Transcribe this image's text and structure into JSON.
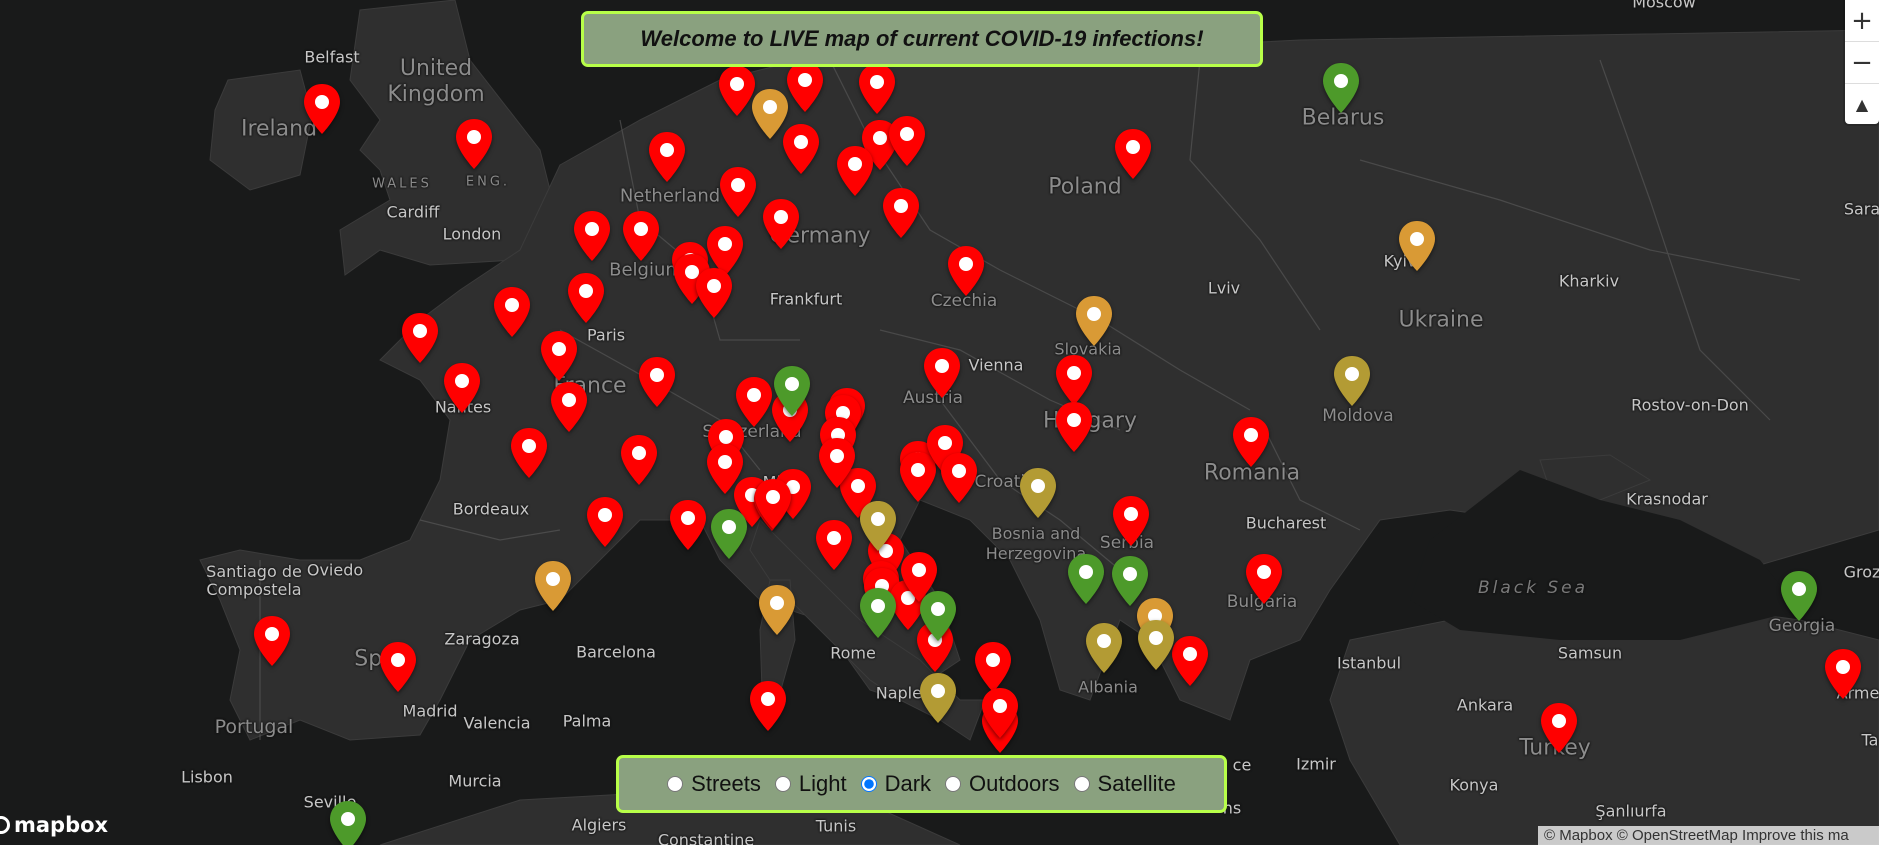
{
  "banner": {
    "title": "Welcome to LIVE map of current COVID-19 infections!"
  },
  "zoom_controls": {
    "zoom_in": "+",
    "zoom_out": "−",
    "compass": "▲"
  },
  "style_switcher": {
    "selected": "Dark",
    "options": [
      "Streets",
      "Light",
      "Dark",
      "Outdoors",
      "Satellite"
    ]
  },
  "attribution": {
    "logo": "mapbox",
    "text": "© Mapbox © OpenStreetMap Improve this ma"
  },
  "marker_colors": {
    "red": "#ff0000",
    "orange": "#d99a35",
    "olive": "#b39b34",
    "green": "#4d9a2a"
  },
  "labels": {
    "countries": [
      "Ireland",
      "United Kingdom",
      "Netherland",
      "Belgium",
      "Germany",
      "Poland",
      "Belarus",
      "Ukraine",
      "Czechia",
      "Slovakia",
      "Austria",
      "Hungary",
      "Switzerland",
      "France",
      "Moldova",
      "Romania",
      "Croatia",
      "Bosnia and Herzegovina",
      "Serbia",
      "Bulgaria",
      "Albania",
      "Spain",
      "Portugal",
      "Turkey",
      "Georgia"
    ],
    "cities": [
      "Belfast",
      "Cardiff",
      "London",
      "Paris",
      "Frankfurt",
      "Vienna",
      "Lviv",
      "Kyiv",
      "Kharkiv",
      "Rostov-on-Don",
      "Krasnodar",
      "Nantes",
      "Bordeaux",
      "Milan",
      "Bucharest",
      "Oviedo",
      "Santiago de Compostela",
      "Zaragoza",
      "Barcelona",
      "Madrid",
      "Valencia",
      "Palma",
      "Lisbon",
      "Murcia",
      "Seville",
      "Algiers",
      "Constantine",
      "Tunis",
      "Rome",
      "Naples",
      "Istanbul",
      "Samsun",
      "Ankara",
      "Izmir",
      "Konya",
      "Şanlıurfa",
      "Moscow",
      "Sara",
      "Groz",
      "Arme",
      "Ta",
      "ce",
      "ns"
    ],
    "regions": [
      "WALES",
      "ENG."
    ],
    "seas": [
      "Black Sea"
    ]
  },
  "markers": {
    "red": 66,
    "orange": 5,
    "olive": 6,
    "green": 9
  }
}
